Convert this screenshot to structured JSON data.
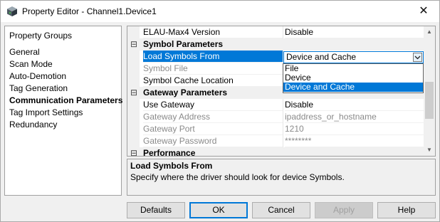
{
  "window": {
    "title": "Property Editor - Channel1.Device1",
    "close_glyph": "✕",
    "app_icon": "device-cube-icon"
  },
  "groups": {
    "header": "Property Groups",
    "items": [
      {
        "label": "General",
        "selected": false
      },
      {
        "label": "Scan Mode",
        "selected": false
      },
      {
        "label": "Auto-Demotion",
        "selected": false
      },
      {
        "label": "Tag Generation",
        "selected": false
      },
      {
        "label": "Communication Parameters",
        "selected": true
      },
      {
        "label": "Tag Import Settings",
        "selected": false
      },
      {
        "label": "Redundancy",
        "selected": false
      }
    ]
  },
  "grid": {
    "rows": [
      {
        "type": "prop",
        "name": "ELAU-Max4 Version",
        "value": "Disable",
        "disabled": false
      },
      {
        "type": "cat",
        "toggle": "⊟",
        "name": "Symbol Parameters"
      },
      {
        "type": "prop",
        "name": "Load Symbols From",
        "value": "Device and Cache",
        "disabled": false,
        "selected": true
      },
      {
        "type": "prop",
        "name": "Symbol File",
        "value": "",
        "disabled": true
      },
      {
        "type": "prop",
        "name": "Symbol Cache Location",
        "value": "",
        "disabled": false
      },
      {
        "type": "cat",
        "toggle": "⊟",
        "name": "Gateway Parameters"
      },
      {
        "type": "prop",
        "name": "Use Gateway",
        "value": "Disable",
        "disabled": false
      },
      {
        "type": "prop",
        "name": "Gateway Address",
        "value": "ipaddress_or_hostname",
        "disabled": true
      },
      {
        "type": "prop",
        "name": "Gateway Port",
        "value": "1210",
        "disabled": true
      },
      {
        "type": "prop",
        "name": "Gateway Password",
        "value": "********",
        "disabled": true
      },
      {
        "type": "cat",
        "toggle": "⊟",
        "name": "Performance"
      }
    ],
    "combo": {
      "value": "Device and Cache"
    },
    "dropdown_options": [
      {
        "label": "File",
        "selected": false
      },
      {
        "label": "Device",
        "selected": false
      },
      {
        "label": "Device and Cache",
        "selected": true
      }
    ],
    "scroll_up": "▲",
    "scroll_down": "▼"
  },
  "description": {
    "title": "Load Symbols From",
    "text": "Specify where the driver should look for device Symbols."
  },
  "buttons": {
    "defaults": "Defaults",
    "ok": "OK",
    "cancel": "Cancel",
    "apply": "Apply",
    "help": "Help"
  },
  "colors": {
    "selection": "#0078d7",
    "disabled_text": "#8a8a8a"
  }
}
